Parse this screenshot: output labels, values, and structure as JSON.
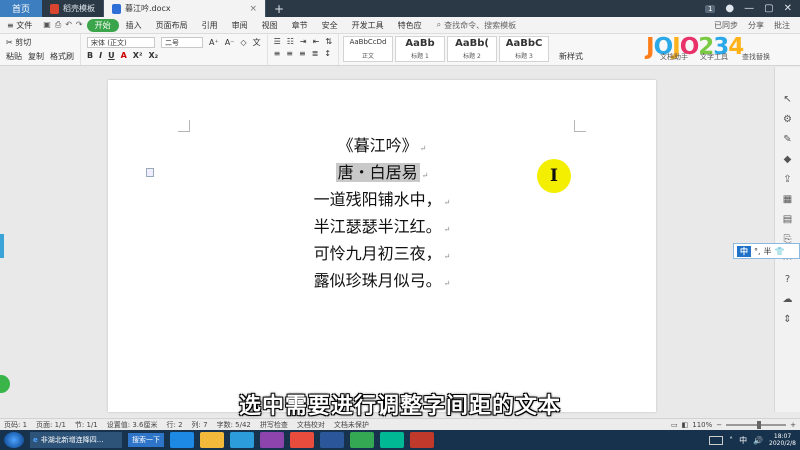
{
  "tabs": {
    "home": "首页",
    "docs": [
      {
        "label": "稻壳模板",
        "active": false
      },
      {
        "label": "暮江吟.docx",
        "active": true
      }
    ],
    "new_tab": "+",
    "badge": "1"
  },
  "menu": {
    "file": "文件",
    "items": [
      "开始",
      "插入",
      "页面布局",
      "引用",
      "审阅",
      "视图",
      "章节",
      "安全",
      "开发工具",
      "特色应"
    ],
    "search_placeholder": "查找命令、搜索模板",
    "right": [
      "已同步",
      "分享",
      "批注"
    ]
  },
  "ribbon": {
    "clipboard": {
      "paste": "粘贴",
      "cut": "剪切",
      "copy": "复制",
      "format_painter": "格式刷"
    },
    "font_name": "宋体 (正文)",
    "font_size": "二号",
    "format_buttons": [
      "B",
      "I",
      "U",
      "A",
      "X²",
      "X₂"
    ],
    "styles": [
      {
        "sample": "AaBbCcDd",
        "name": "正文"
      },
      {
        "sample": "AaBb",
        "name": "标题 1"
      },
      {
        "sample": "AaBb(",
        "name": "标题 2"
      },
      {
        "sample": "AaBbC",
        "name": "标题 3"
      }
    ],
    "new_style": "新样式",
    "right_labels": [
      "文档助手",
      "文字工具",
      "查找替换"
    ],
    "logo_letters": [
      "J",
      "O",
      "J",
      "O",
      "2",
      "3",
      "4"
    ]
  },
  "document": {
    "title": "《暮江吟》",
    "author": "唐・白居易",
    "lines": [
      "一道残阳铺水中，",
      "半江瑟瑟半江红。",
      "可怜九月初三夜，",
      "露似珍珠月似弓。"
    ],
    "paragraph_mark": "↵",
    "cursor_glyph": "I"
  },
  "ime": {
    "mode": "中",
    "punct": "°,",
    "extra": "半"
  },
  "subtitle": "选中需要进行调整字间距的文本",
  "statusbar": {
    "page": "页码: 1",
    "pages": "页面: 1/1",
    "section": "节: 1/1",
    "settings": "设置值: 3.6厘米",
    "row": "行: 2",
    "col": "列: 7",
    "words": "字数: 5/42",
    "spellcheck": "拼写检查",
    "doc_check": "文档校对",
    "protect": "文档未保护",
    "zoom": "110%",
    "zoom_value": 0.55
  },
  "taskbar": {
    "ie_label": "非湖北新增连降四...",
    "search_label": "搜索一下",
    "ime": "中",
    "clock_time": "18:07",
    "clock_date": "2020/2/8"
  },
  "colors": {
    "accent_green": "#3aa54a",
    "tabbar_bg": "#2b3947",
    "highlight": "#f4ee00",
    "selection": "#c9c9c9"
  }
}
